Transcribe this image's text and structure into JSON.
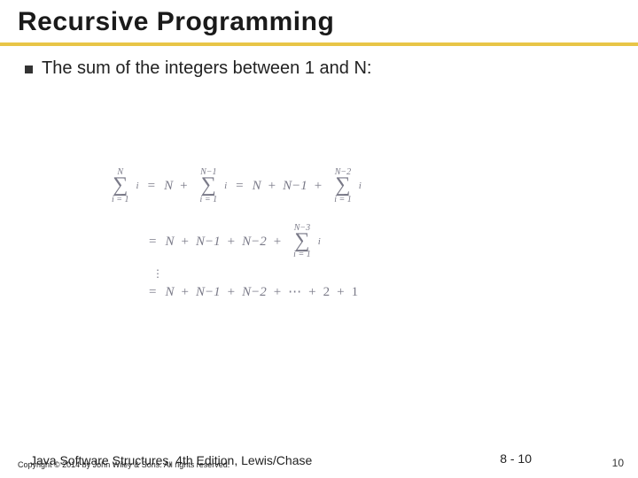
{
  "title": "Recursive Programming",
  "bullet": "The sum of the integers between 1 and N:",
  "eq": {
    "sigma_sym": "∑",
    "eq_sign": "=",
    "plus_sign": "+",
    "i_label": "i",
    "idx_from_prefix": "i = 1",
    "N": "N",
    "Nm1": "N−1",
    "Nm2": "N−2",
    "Nm3": "N−3",
    "dots": "⋯",
    "two": "2",
    "one": "1",
    "vdots": "⋮"
  },
  "footer": {
    "book": "Java Software Structures, 4th Edition, Lewis/Chase",
    "copyright": "Copyright © 2014 by John Wiley & Sons. All rights reserved.",
    "page_label": "8 - 10",
    "slide_num": "10"
  }
}
